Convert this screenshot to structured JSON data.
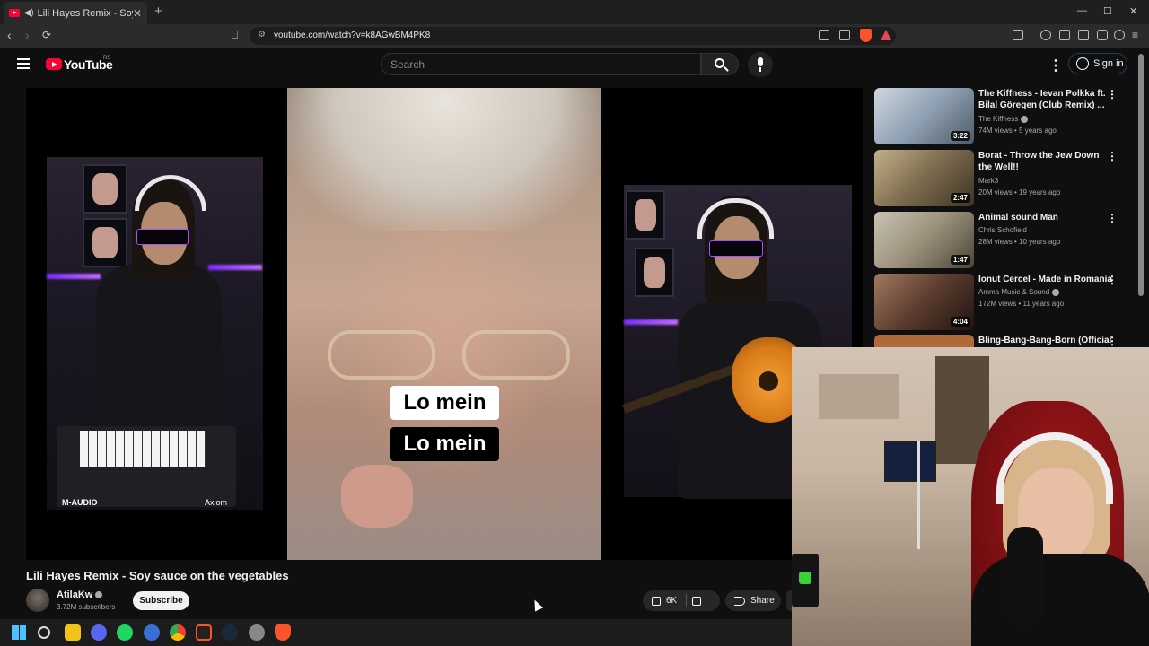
{
  "browser": {
    "tab_title": "Lili Hayes Remix - Soy sauce o",
    "tab_close": "✕",
    "new_tab": "+",
    "url": "youtube.com/watch?v=k8AGwBM4PK8",
    "controls": {
      "minimize": "—",
      "maximize": "☐",
      "close": "✕"
    }
  },
  "youtube": {
    "logo_text": "YouTube",
    "region": "RS",
    "search_placeholder": "Search",
    "sign_in": "Sign in"
  },
  "video": {
    "captions": [
      "Lo mein",
      "Lo mein"
    ],
    "left_panel_brand": "M-AUDIO",
    "left_panel_model": "Axiom",
    "title": "Lili Hayes Remix - Soy sauce on the vegetables",
    "channel": "AtilaKw",
    "subscribers": "3.72M subscribers",
    "subscribe_label": "Subscribe",
    "likes": "6K",
    "share_label": "Share"
  },
  "recommendations": [
    {
      "title": "The Kiffness - Ievan Polkka ft. Bilal Göregen (Club Remix) ...",
      "channel": "The Kiffness",
      "verified": true,
      "meta": "74M views • 5 years ago",
      "duration": "3:22",
      "thumb_color": "#8fa0b3"
    },
    {
      "title": "Borat - Throw the Jew Down the Well!!",
      "channel": "Mark3",
      "verified": false,
      "meta": "20M views • 19 years ago",
      "duration": "2:47",
      "thumb_color": "#7c6a4e"
    },
    {
      "title": "Animal sound Man",
      "channel": "Chris Schofield",
      "verified": false,
      "meta": "28M views • 10 years ago",
      "duration": "1:47",
      "thumb_color": "#9a8f7a"
    },
    {
      "title": "Ionut Cercel - Made in Romania",
      "channel": "Amma Music & Sound",
      "verified": true,
      "meta": "172M views • 11 years ago",
      "duration": "4:04",
      "thumb_color": "#5b3b2e"
    },
    {
      "title": "Bling-Bang-Bang-Born (Official",
      "channel": "",
      "verified": false,
      "meta": "",
      "duration": "",
      "thumb_color": "#b06a3a"
    }
  ],
  "colors": {
    "youtube_red": "#ff0033",
    "background": "#0f0f0f"
  }
}
